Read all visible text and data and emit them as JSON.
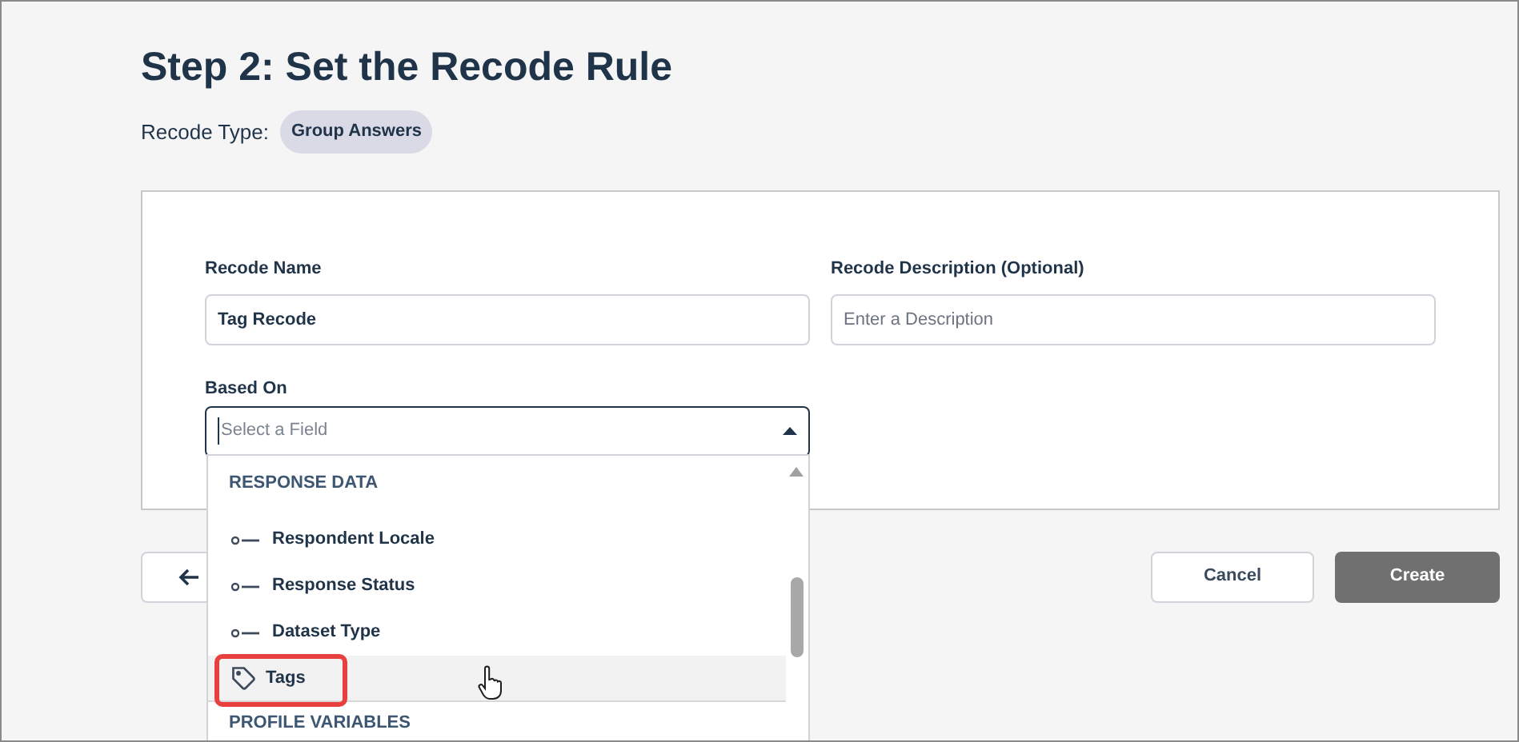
{
  "title": "Step 2: Set the Recode Rule",
  "recode_type": {
    "label": "Recode Type:",
    "value": "Group Answers"
  },
  "form": {
    "name": {
      "label": "Recode Name",
      "value": "Tag Recode"
    },
    "description": {
      "label": "Recode Description (Optional)",
      "placeholder": "Enter a Description"
    },
    "based_on": {
      "label": "Based On",
      "placeholder": "Select a Field",
      "expanded": true
    }
  },
  "dropdown": {
    "items": [
      {
        "kind": "group",
        "label": "RESPONSE DATA"
      },
      {
        "kind": "field",
        "label": "Respondent Locale",
        "selected": false
      },
      {
        "kind": "field",
        "label": "Response Status",
        "selected": false
      },
      {
        "kind": "field",
        "label": "Dataset Type",
        "selected": false
      },
      {
        "kind": "tag",
        "label": "Tags",
        "selected": true
      },
      {
        "kind": "group",
        "label": "PROFILE VARIABLES"
      }
    ]
  },
  "buttons": {
    "cancel": "Cancel",
    "create": "Create"
  }
}
